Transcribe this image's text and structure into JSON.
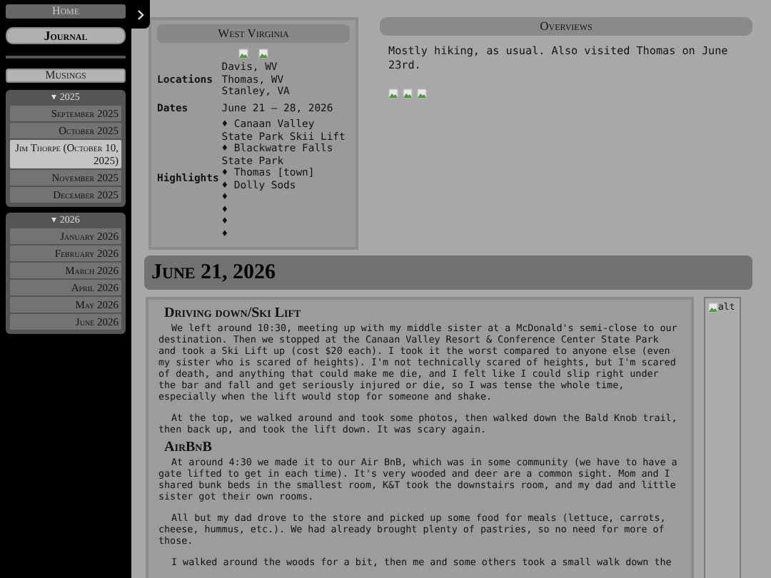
{
  "nav": [
    {
      "label": "Home",
      "selected": false
    },
    {
      "label": "Journal",
      "selected": true
    }
  ],
  "musings": {
    "label": "Musings"
  },
  "archive": [
    {
      "label": "▾ 2025",
      "items": [
        {
          "label": "September 2025",
          "selected": false
        },
        {
          "label": "October 2025",
          "selected": false
        },
        {
          "label": "Jim Thorpe (October 10, 2025)",
          "selected": true
        },
        {
          "label": "November 2025",
          "selected": false
        },
        {
          "label": "December 2025",
          "selected": false
        }
      ]
    },
    {
      "label": "▾ 2026",
      "items": [
        {
          "label": "January 2026",
          "selected": false
        },
        {
          "label": "February 2026",
          "selected": false
        },
        {
          "label": "March 2026",
          "selected": false
        },
        {
          "label": "April 2026",
          "selected": false
        },
        {
          "label": "May 2026",
          "selected": false
        },
        {
          "label": "June 2026",
          "selected": false
        }
      ]
    }
  ],
  "trip": {
    "title": "West Virginia",
    "fields": [
      {
        "label": "Locations",
        "values": [
          "Davis, WV",
          "Thomas, WV",
          "Stanley, VA"
        ]
      },
      {
        "label": "Dates",
        "values": [
          "June 21 – 28, 2026"
        ]
      },
      {
        "label": "Highlights",
        "values": [
          "♦ Canaan Valley State Park Skii Lift",
          "♦ Blackwatre Falls State Park",
          "♦ Thomas [town]",
          "♦ Dolly Sods",
          "♦",
          "♦",
          "♦",
          "♦"
        ]
      }
    ]
  },
  "overview": {
    "title": "Overviews",
    "text": "Mostly hiking, as usual. Also visited Thomas on June 23rd."
  },
  "day": {
    "heading": "June 21, 2026",
    "sections": [
      {
        "heading": "Driving down/Ski Lift",
        "paragraphs": [
          "We left around 10:30, meeting up with my middle sister at a McDonald's semi-close to our destination. Then we stopped at the Canaan Valley Resort & Conference Center State Park and took a Ski Lift up (cost $20 each). I took it the worst compared to anyone else (even my sister who is scared of heights). I'm not technically scared of heights, but I'm scared of death, and anything that could make me die, and I felt like I could slip right under the bar and fall and get seriously injured or die, so I was tense the whole time, especially when the lift would stop for someone and shake.",
          "At the top, we walked around and took some photos, then walked down the Bald Knob trail, then back up, and took the lift down. It was scary again."
        ]
      },
      {
        "heading": "AirBnB",
        "paragraphs": [
          "At around 4:30 we made it to our Air BnB, which was in some community (we have to have a gate lifted to get in each time). It's very wooded and deer are a common sight. Mom and I shared bunk beds in the smallest room, K&T took the downstairs room, and my dad and little sister got their own rooms.",
          "All but my dad drove to the store and picked up some food for meals (lettuce, carrots, cheese, hummus, etc.). We had already brought plenty of pastries, so no need for more of those.",
          "I walked around the woods for a bit, then me and some others took a small walk down the"
        ]
      }
    ],
    "image_alt": "alt"
  }
}
